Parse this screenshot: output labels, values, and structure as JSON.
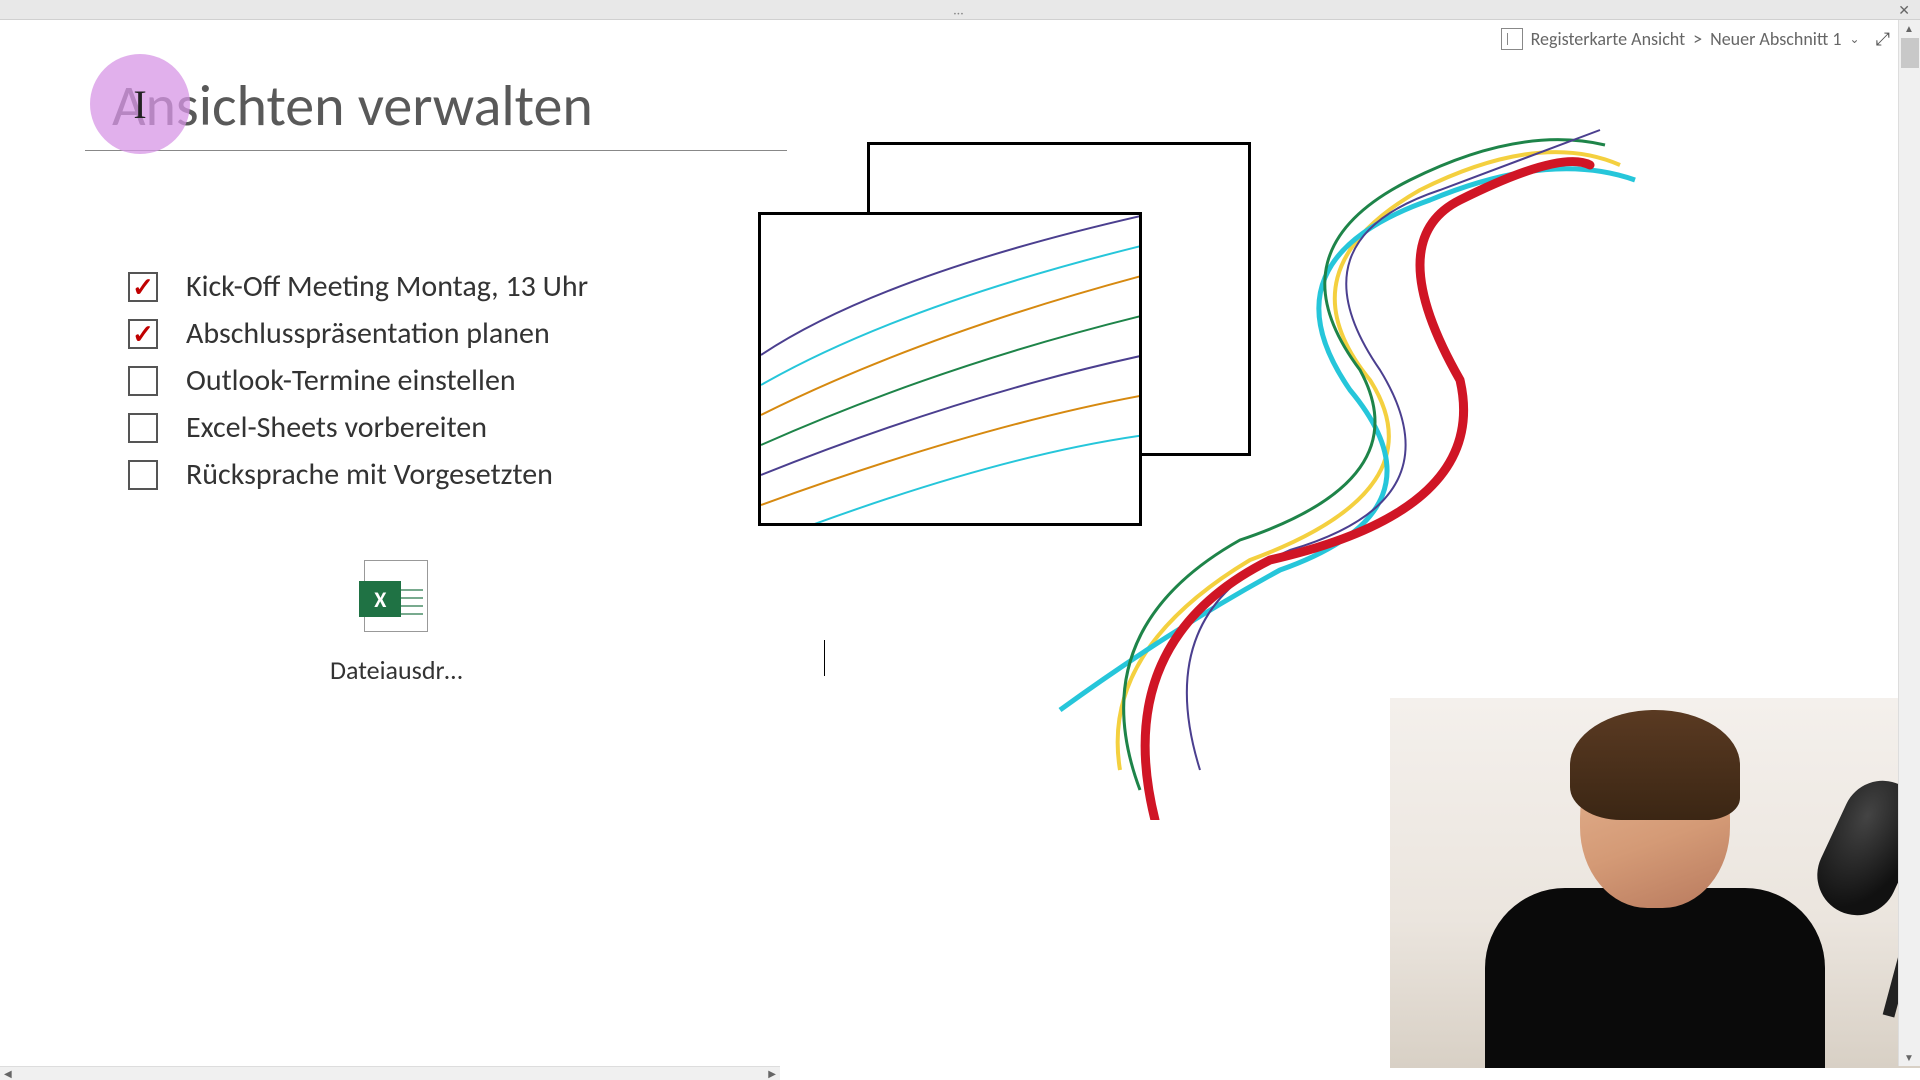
{
  "titlebar": {
    "dots": "…"
  },
  "breadcrumb": {
    "path1": "Registerkarte Ansicht",
    "sep": ">",
    "path2": "Neuer Abschnitt 1"
  },
  "page": {
    "title": "Ansichten verwalten"
  },
  "checklist": [
    {
      "label": "Kick-Off Meeting Montag, 13 Uhr",
      "checked": true
    },
    {
      "label": "Abschlusspräsentation planen",
      "checked": true
    },
    {
      "label": "Outlook-Termine einstellen",
      "checked": false
    },
    {
      "label": "Excel-Sheets vorbereiten",
      "checked": false
    },
    {
      "label": "Rücksprache mit Vorgesetzten",
      "checked": false
    }
  ],
  "attachment": {
    "label": "Dateiausdr…",
    "badge": "X"
  },
  "colors": {
    "red": "#D01525",
    "cyan": "#26C6DA",
    "green": "#1E8449",
    "yellow": "#F4D03F",
    "purple": "#4B3F8F",
    "orange": "#D68910"
  }
}
